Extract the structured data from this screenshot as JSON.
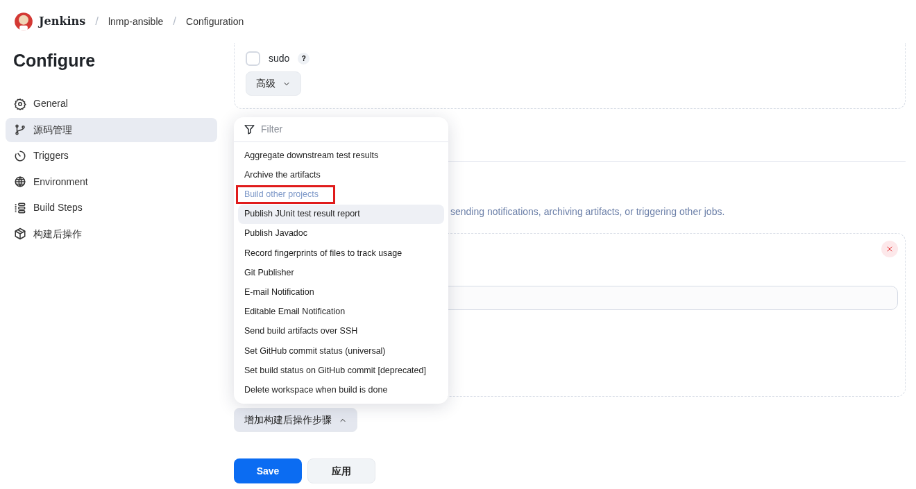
{
  "breadcrumb": {
    "logo_text": "Jenkins",
    "items": [
      {
        "label": "lnmp-ansible",
        "separator": "/"
      },
      {
        "label": "Configuration",
        "separator": "/"
      }
    ]
  },
  "sidebar": {
    "title": "Configure",
    "items": [
      {
        "label": "General",
        "selected": false
      },
      {
        "label": "源码管理",
        "selected": true
      },
      {
        "label": "Triggers",
        "selected": false
      },
      {
        "label": "Environment",
        "selected": false
      },
      {
        "label": "Build Steps",
        "selected": false
      },
      {
        "label": "构建后操作",
        "selected": false
      }
    ]
  },
  "options": [
    {
      "kind": "checkbox",
      "label": "sudo",
      "checked": false,
      "help": "?"
    }
  ],
  "advanced_button": {
    "label": "高级",
    "expanded": false
  },
  "description": "sending notifications, archiving artifacts, or triggering other jobs.",
  "dropdown": {
    "placeholder": "Filter",
    "items": [
      {
        "label": "Aggregate downstream test results",
        "hovered": false,
        "marked": false
      },
      {
        "label": "Archive the artifacts",
        "hovered": false,
        "marked": false
      },
      {
        "label": "Build other projects",
        "hovered": false,
        "marked": true
      },
      {
        "label": "Publish JUnit test result report",
        "hovered": true,
        "marked": false
      },
      {
        "label": "Publish Javadoc",
        "hovered": false,
        "marked": false
      },
      {
        "label": "Record fingerprints of files to track usage",
        "hovered": false,
        "marked": false
      },
      {
        "label": "Git Publisher",
        "hovered": false,
        "marked": false
      },
      {
        "label": "E-mail Notification",
        "hovered": false,
        "marked": false
      },
      {
        "label": "Editable Email Notification",
        "hovered": false,
        "marked": false
      },
      {
        "label": "Send build artifacts over SSH",
        "hovered": false,
        "marked": false
      },
      {
        "label": "Set GitHub commit status (universal)",
        "hovered": false,
        "marked": false
      },
      {
        "label": "Set build status on GitHub commit [deprecated]",
        "hovered": false,
        "marked": false
      },
      {
        "label": "Delete workspace when build is done",
        "hovered": false,
        "marked": false
      }
    ]
  },
  "add_step_button": {
    "label": "增加构建后操作步骤",
    "expanded": true
  },
  "buttons": [
    {
      "label": "Save",
      "kind": "primary"
    },
    {
      "label": "应用",
      "kind": "secondary"
    }
  ]
}
